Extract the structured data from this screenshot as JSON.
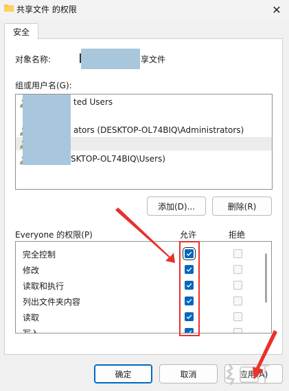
{
  "window": {
    "title": "共享文件 的权限",
    "close_glyph": "✕"
  },
  "tabs": [
    {
      "label": "安全"
    }
  ],
  "object": {
    "label": "对象名称:",
    "value_suffix": "享文件"
  },
  "users": {
    "label": "组或用户名(G):",
    "items": [
      {
        "text": "ted Users",
        "selected": false
      },
      {
        "text": "ators (DESKTOP-OL74BIQ\\Administrators)",
        "selected": false
      },
      {
        "text": "",
        "selected": true
      },
      {
        "text": "SKTOP-OL74BIQ\\Users)",
        "selected": false
      }
    ]
  },
  "buttons": {
    "add": "添加(D)...",
    "remove": "删除(R)",
    "ok": "确定",
    "cancel": "取消",
    "apply": "应用(A)"
  },
  "permissions": {
    "label": "Everyone 的权限(P)",
    "allow_header": "允许",
    "deny_header": "拒绝",
    "rows": [
      {
        "name": "完全控制",
        "allow": true,
        "deny": false
      },
      {
        "name": "修改",
        "allow": true,
        "deny": false
      },
      {
        "name": "读取和执行",
        "allow": true,
        "deny": false
      },
      {
        "name": "列出文件夹内容",
        "allow": true,
        "deny": false
      },
      {
        "name": "读取",
        "allow": true,
        "deny": false
      },
      {
        "name": "写入",
        "allow": true,
        "deny": false
      }
    ]
  },
  "colors": {
    "accent": "#0067c0",
    "annotation_red": "#e8322a",
    "redaction": "#a9c7dc"
  }
}
